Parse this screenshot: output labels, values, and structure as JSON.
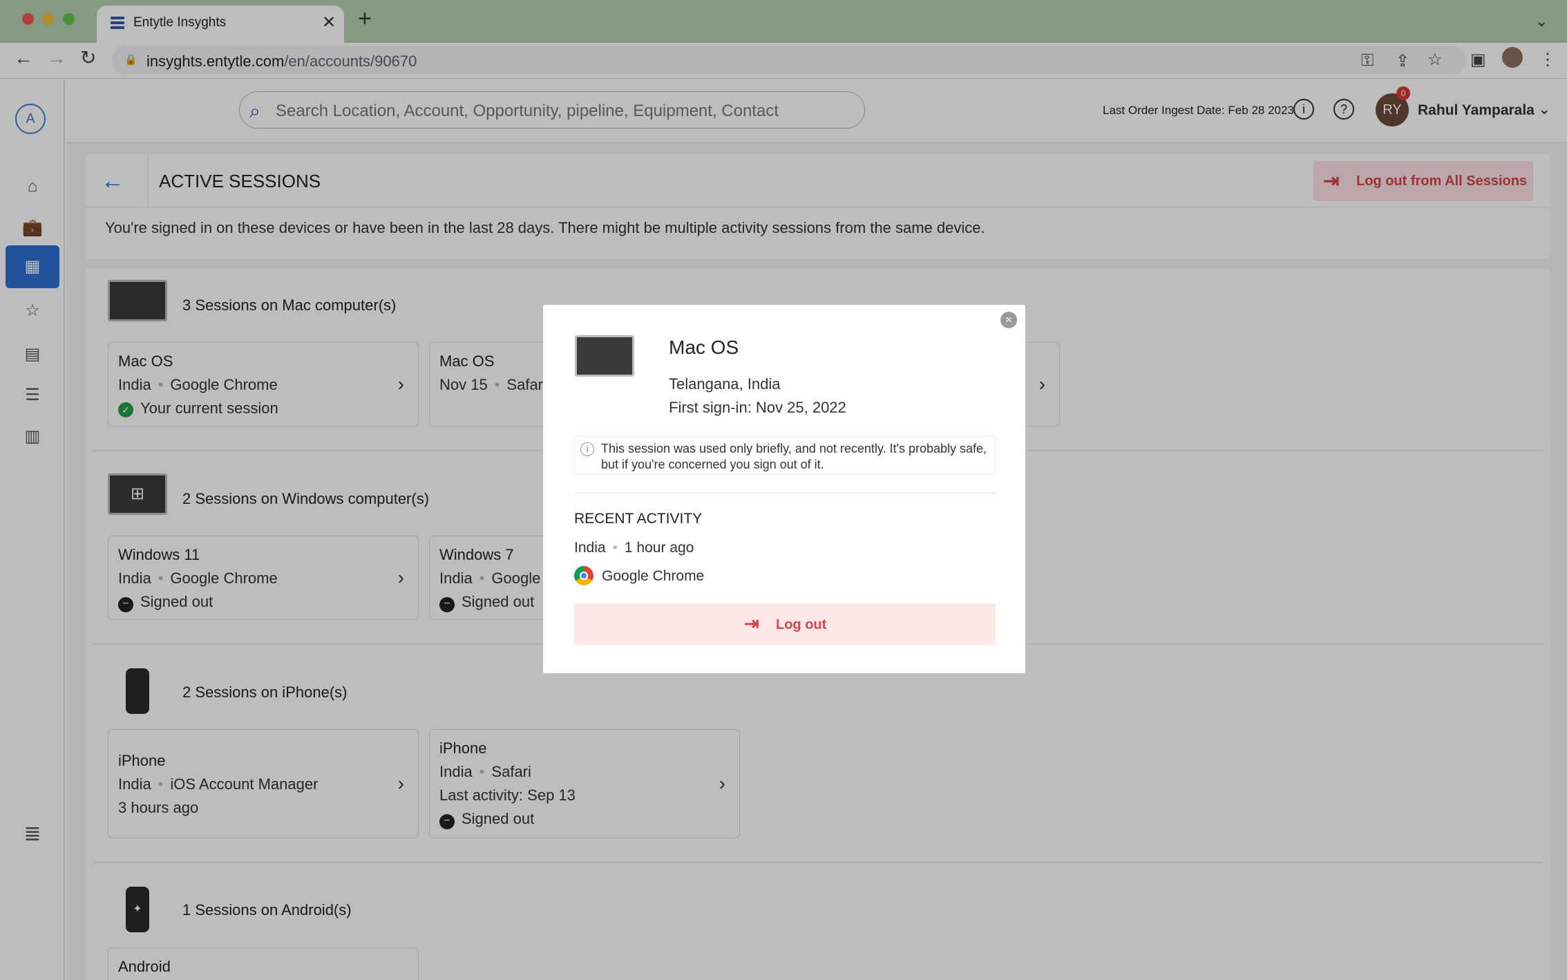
{
  "browser": {
    "tab_title": "Entytle Insyghts",
    "url_domain": "insyghts.entytle.com",
    "url_path": "/en/accounts/90670"
  },
  "header": {
    "search_placeholder": "Search Location, Account, Opportunity, pipeline, Equipment, Contact",
    "ingest_label": "Last Order Ingest Date: Feb 28 2023",
    "avatar_initials": "RY",
    "notification_count": "0",
    "user_name": "Rahul Yamparala",
    "app_logo": "A"
  },
  "page": {
    "title": "ACTIVE SESSIONS",
    "logout_all_label": "Log out from All Sessions",
    "info": "You're signed in on these devices or have been in the last 28 days. There might be multiple activity sessions from the same device."
  },
  "groups": [
    {
      "title": "3 Sessions on Mac computer(s)",
      "cards": [
        {
          "name": "Mac OS",
          "country": "India",
          "browser": "Google Chrome",
          "status": "Your current session"
        },
        {
          "name": "Mac OS",
          "country": "Nov 15",
          "browser": "Safari"
        }
      ]
    },
    {
      "title": "2 Sessions on Windows computer(s)",
      "cards": [
        {
          "name": "Windows 11",
          "country": "India",
          "browser": "Google Chrome",
          "status": "Signed out"
        },
        {
          "name": "Windows 7",
          "country": "India",
          "browser": "Google",
          "status": "Signed out"
        }
      ]
    },
    {
      "title": "2 Sessions on iPhone(s)",
      "cards": [
        {
          "name": "iPhone",
          "country": "India",
          "browser": "iOS Account Manager",
          "status": "3 hours ago"
        },
        {
          "name": "iPhone",
          "country": "India",
          "browser": "Safari",
          "last_activity": "Last activity: Sep 13",
          "status": "Signed out"
        }
      ]
    },
    {
      "title": "1 Sessions on Android(s)",
      "cards": [
        {
          "name": "Android"
        }
      ]
    }
  ],
  "modal": {
    "os": "Mac OS",
    "location": "Telangana, India",
    "first_signin": "First sign-in: Nov 25, 2022",
    "note": "This session was used only briefly, and not recently. It's probably safe, but if you're concerned you sign out of it.",
    "recent_heading": "RECENT ACTIVITY",
    "recent_country": "India",
    "recent_time": "1 hour ago",
    "recent_browser": "Google Chrome",
    "logout_label": "Log out"
  },
  "colors": {
    "accent": "#2f6fd1",
    "danger": "#d2444e",
    "danger_bg": "#fde2e2",
    "success": "#23a047"
  }
}
